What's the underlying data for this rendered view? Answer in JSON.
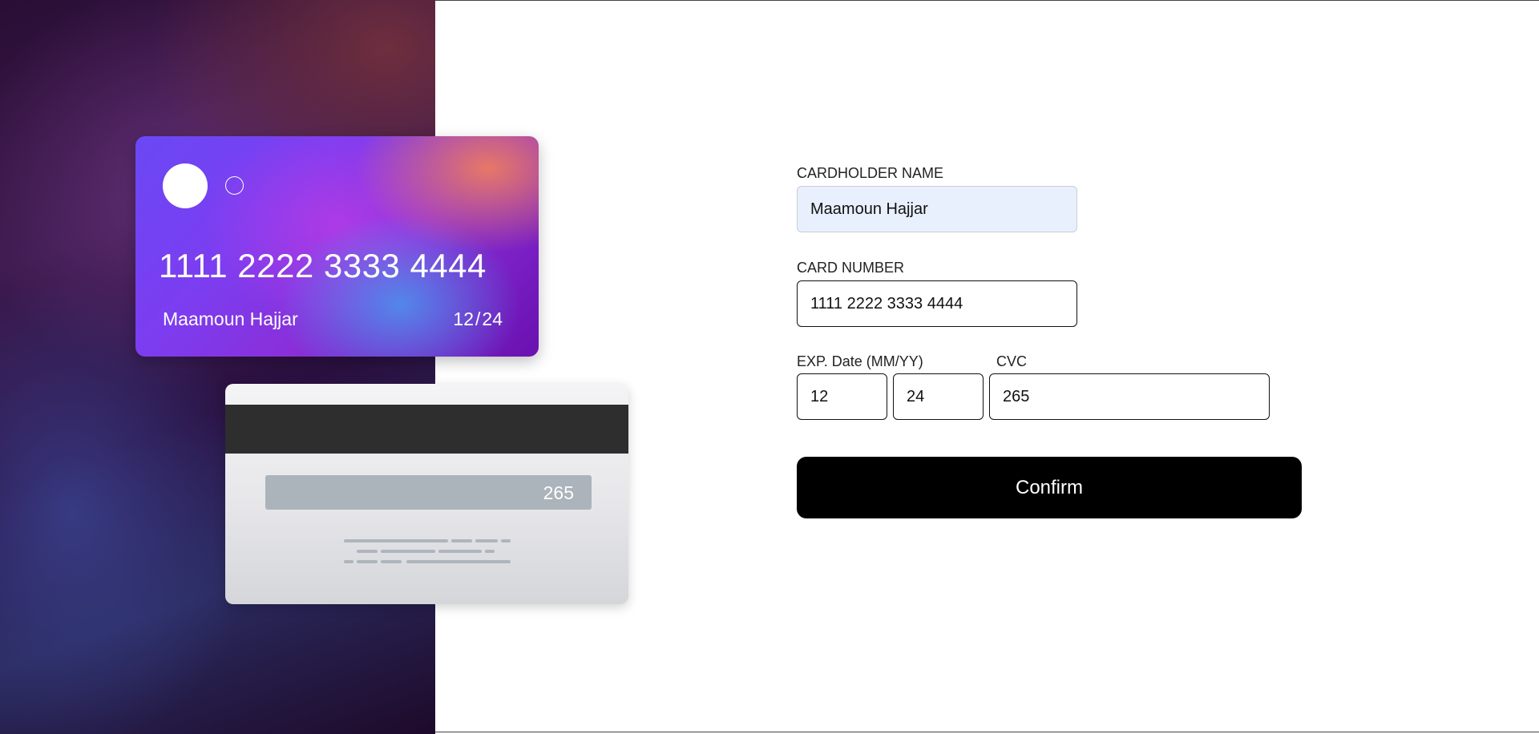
{
  "card_front": {
    "number": "1111 2222 3333 4444",
    "holder_name": "Maamoun Hajjar",
    "exp_month": "12",
    "exp_separator": "/",
    "exp_year": "24"
  },
  "card_back": {
    "cvc": "265"
  },
  "form": {
    "name_label": "CARDHOLDER NAME",
    "name_value": "Maamoun Hajjar",
    "number_label": "CARD NUMBER",
    "number_value": "1111 2222 3333 4444",
    "exp_label": "EXP. Date (MM/YY)",
    "exp_month_value": "12",
    "exp_year_value": "24",
    "cvc_label": "CVC",
    "cvc_value": "265",
    "confirm_label": "Confirm"
  },
  "colors": {
    "button_bg": "#000000",
    "autofill_bg": "#e8f0fe",
    "back_strip": "#2e2e2e",
    "signature_box": "#abb3bb"
  }
}
